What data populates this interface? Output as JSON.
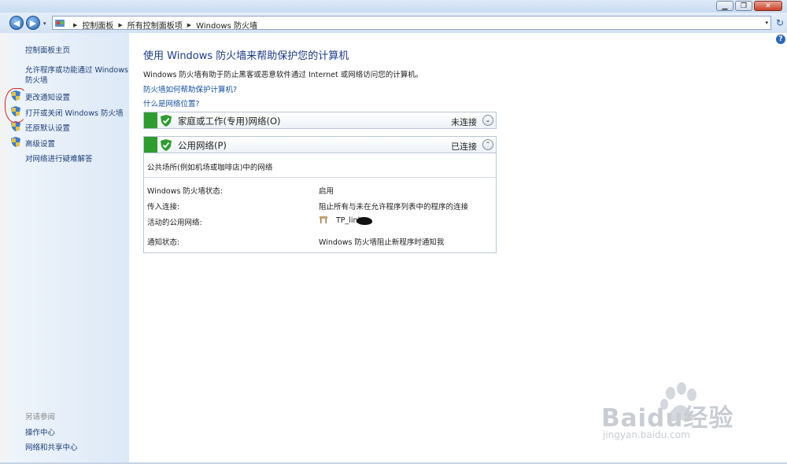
{
  "window": {
    "minimize_label": "▁",
    "maximize_label": "❐",
    "close_label": "✕"
  },
  "nav": {
    "back_icon": "◀",
    "forward_icon": "▶",
    "dropdown_icon": "▾",
    "breadcrumbs": [
      "控制面板",
      "所有控制面板项",
      "Windows 防火墙"
    ],
    "refresh_icon": "↻"
  },
  "sidebar": {
    "home": "控制面板主页",
    "allow_programs": "允许程序或功能通过 Windows 防火墙",
    "change_notifications": "更改通知设置",
    "toggle_firewall": "打开或关闭 Windows 防火墙",
    "restore_defaults": "还原默认设置",
    "advanced": "高级设置",
    "troubleshoot": "对网络进行疑难解答",
    "see_also_heading": "另请参阅",
    "action_center": "操作中心",
    "network_center": "网络和共享中心"
  },
  "main": {
    "title": "使用 Windows 防火墙来帮助保护您的计算机",
    "description": "Windows 防火墙有助于防止黑客或恶意软件通过 Internet 或网络访问您的计算机。",
    "link_how": "防火墙如何帮助保护计算机?",
    "link_location": "什么是网络位置?",
    "help_icon": "?"
  },
  "networks": [
    {
      "name": "家庭或工作(专用)网络(O)",
      "status": "未连接",
      "chevron": "⌄"
    },
    {
      "name": "公用网络(P)",
      "status": "已连接",
      "chevron": "⌃"
    }
  ],
  "public_details": {
    "description": "公共场所(例如机场或咖啡店)中的网络",
    "rows": [
      {
        "label": "Windows 防火墙状态:",
        "value": "启用"
      },
      {
        "label": "传入连接:",
        "value": "阻止所有与未在允许程序列表中的程序的连接"
      },
      {
        "label": "活动的公用网络:",
        "value": "TP_link"
      },
      {
        "label": "通知状态:",
        "value": "Windows 防火墙阻止新程序时通知我"
      }
    ]
  },
  "watermark": {
    "brand": "Baidu经验",
    "url": "jingyan.baidu.com"
  },
  "colors": {
    "accent_green": "#2e9c2e",
    "link_blue": "#1550a7",
    "sidebar_bg": "#dde9f7",
    "annotation_red": "#d22"
  }
}
